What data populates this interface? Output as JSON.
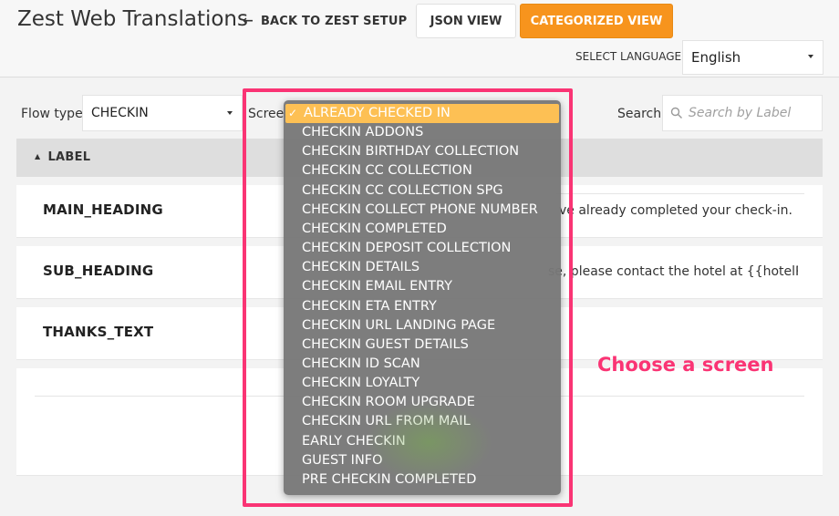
{
  "header": {
    "title": "Zest Web Translations",
    "back_label": "BACK TO ZEST SETUP",
    "json_view_label": "JSON VIEW",
    "categorized_view_label": "CATEGORIZED VIEW",
    "select_language_label": "SELECT LANGUAGE",
    "language_value": "English"
  },
  "filters": {
    "flow_type_label": "Flow type",
    "flow_type_value": "CHECKIN",
    "screen_label": "Screen",
    "search_label": "Search",
    "search_placeholder": "Search by Label"
  },
  "table": {
    "column_header": "LABEL",
    "rows": [
      {
        "key": "MAIN_HEADING",
        "value": "ve already completed your check-in."
      },
      {
        "key": "SUB_HEADING",
        "value": "se, please contact the hotel at {{hotelPho"
      },
      {
        "key": "THANKS_TEXT",
        "value": ""
      }
    ]
  },
  "screen_dropdown": {
    "selected": "ALREADY CHECKED IN",
    "check_glyph": "✓",
    "options": [
      "ALREADY CHECKED IN",
      "CHECKIN ADDONS",
      "CHECKIN BIRTHDAY COLLECTION",
      "CHECKIN CC COLLECTION",
      "CHECKIN CC COLLECTION SPG",
      "CHECKIN COLLECT PHONE NUMBER",
      "CHECKIN COMPLETED",
      "CHECKIN DEPOSIT COLLECTION",
      "CHECKIN DETAILS",
      "CHECKIN EMAIL ENTRY",
      "CHECKIN ETA ENTRY",
      "CHECKIN URL LANDING PAGE",
      "CHECKIN GUEST DETAILS",
      "CHECKIN ID SCAN",
      "CHECKIN LOYALTY",
      "CHECKIN ROOM UPGRADE",
      "CHECKIN URL FROM MAIL",
      "EARLY CHECKIN",
      "GUEST INFO",
      "PRE CHECKIN COMPLETED"
    ]
  },
  "annotation": {
    "text": "Choose a screen"
  },
  "colors": {
    "accent_orange": "#f7941d",
    "highlight_pink": "#fa3474",
    "selected_option": "#fdc054",
    "dropdown_bg": "#787878"
  }
}
